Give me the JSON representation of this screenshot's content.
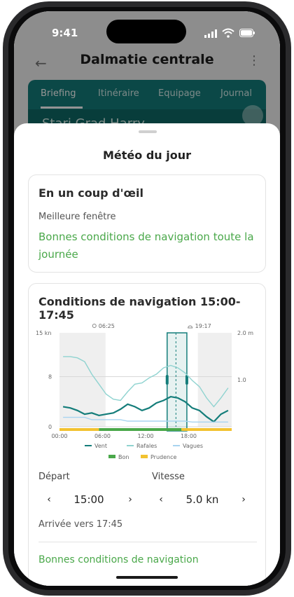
{
  "status": {
    "time": "9:41"
  },
  "header": {
    "title": "Dalmatie centrale"
  },
  "tabs": [
    {
      "label": "Briefing"
    },
    {
      "label": "Itinéraire"
    },
    {
      "label": "Equipage"
    },
    {
      "label": "Journal"
    }
  ],
  "banner": {
    "text": "Stari Grad Harry"
  },
  "sheet": {
    "title": "Météo du jour",
    "glance": {
      "title": "En un coup d'œil",
      "label": "Meilleure fenêtre",
      "value": "Bonnes conditions de navigation toute la journée"
    },
    "conditions": {
      "title": "Conditions de navigation 15:00-17:45",
      "depart_label": "Départ",
      "depart_value": "15:00",
      "speed_label": "Vitesse",
      "speed_value": "5.0 kn",
      "arrival": "Arrivée vers 17:45",
      "summary": "Bonnes conditions de navigation"
    }
  },
  "chart_data": {
    "type": "line",
    "x": [
      "00:00",
      "01:00",
      "02:00",
      "03:00",
      "04:00",
      "05:00",
      "06:00",
      "07:00",
      "08:00",
      "09:00",
      "10:00",
      "11:00",
      "12:00",
      "13:00",
      "14:00",
      "15:00",
      "16:00",
      "17:00",
      "18:00",
      "19:00",
      "20:00",
      "21:00",
      "22:00",
      "23:00"
    ],
    "x_ticks": [
      "00:00",
      "06:00",
      "12:00",
      "18:00"
    ],
    "series": [
      {
        "name": "Vent",
        "axis": "left",
        "color": "#147d7a",
        "values": [
          3.2,
          3.0,
          2.6,
          2.0,
          2.2,
          1.8,
          2.0,
          2.2,
          2.8,
          3.6,
          3.2,
          2.6,
          3.0,
          3.8,
          4.2,
          4.8,
          4.6,
          4.0,
          3.0,
          2.6,
          1.6,
          0.8,
          2.0,
          2.6
        ]
      },
      {
        "name": "Rafales",
        "axis": "left",
        "color": "#8fd3d0",
        "values": [
          11.2,
          11.2,
          11.0,
          10.4,
          8.4,
          6.8,
          5.2,
          4.4,
          4.2,
          5.6,
          6.8,
          7.0,
          7.8,
          8.4,
          9.4,
          9.8,
          9.4,
          8.6,
          7.4,
          6.4,
          4.6,
          3.2,
          4.6,
          6.2
        ]
      },
      {
        "name": "Vagues",
        "axis": "right",
        "color": "#a8d4f0",
        "values": [
          0.2,
          0.2,
          0.2,
          0.2,
          0.15,
          0.15,
          0.15,
          0.15,
          0.15,
          0.12,
          0.12,
          0.12,
          0.12,
          0.12,
          0.12,
          0.12,
          0.12,
          0.12,
          0.1,
          0.1,
          0.1,
          0.1,
          0.1,
          0.1
        ]
      }
    ],
    "left_axis": {
      "ticks": [
        "15 kn",
        "8",
        "0"
      ],
      "range": [
        0,
        15
      ]
    },
    "right_axis": {
      "ticks": [
        "2.0 m",
        "1.0"
      ],
      "range": [
        0,
        2.0
      ]
    },
    "sunrise": "06:25",
    "sunset": "19:17",
    "window": [
      "15:00",
      "17:45"
    ],
    "conditions_bar": [
      {
        "from": 0,
        "to": 5.5,
        "status": "Prudence"
      },
      {
        "from": 5.5,
        "to": 17.0,
        "status": "Bon"
      },
      {
        "from": 17.0,
        "to": 24,
        "status": "Prudence"
      }
    ],
    "legend": [
      "Vent",
      "Rafales",
      "Vagues"
    ],
    "legend2": [
      {
        "label": "Bon",
        "color": "#4aa84a"
      },
      {
        "label": "Prudence",
        "color": "#f2c230"
      }
    ]
  }
}
